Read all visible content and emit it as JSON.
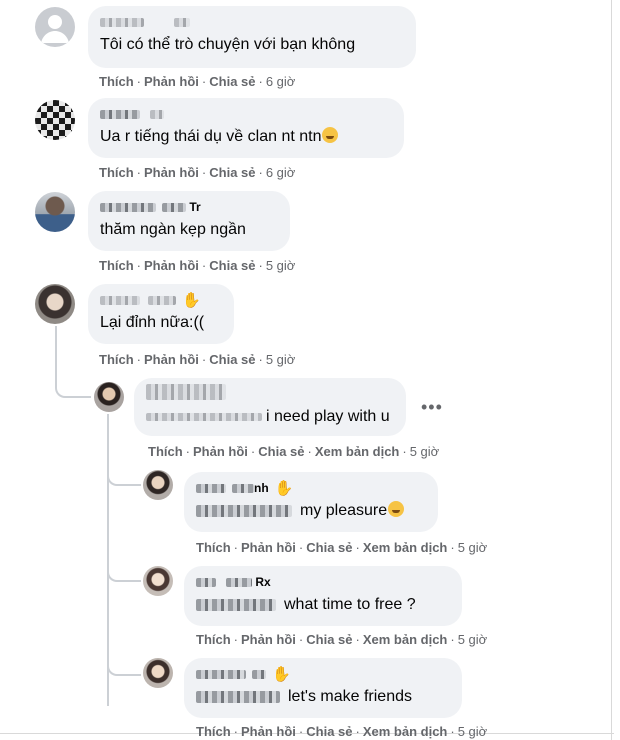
{
  "comments": [
    {
      "author": "",
      "author_suffix": "",
      "text": "Tôi có thể trò chuyện với bạn không",
      "actions": {
        "like": "Thích",
        "reply": "Phản hồi",
        "share": "Chia sẻ",
        "time": "6 giờ"
      }
    },
    {
      "author": "",
      "author_suffix": "",
      "text": "Ua r tiếng thái dụ về clan nt ntn",
      "actions": {
        "like": "Thích",
        "reply": "Phản hồi",
        "share": "Chia sẻ",
        "time": "6 giờ"
      }
    },
    {
      "author": "",
      "author_suffix": "Tr",
      "text": "thăm ngàn kẹp ngần",
      "actions": {
        "like": "Thích",
        "reply": "Phản hồi",
        "share": "Chia sẻ",
        "time": "5 giờ"
      }
    },
    {
      "author": "",
      "author_suffix": "",
      "text": "Lại đỉnh nữa:((",
      "actions": {
        "like": "Thích",
        "reply": "Phản hồi",
        "share": "Chia sẻ",
        "time": "5 giờ"
      }
    }
  ],
  "replies": [
    {
      "author": "",
      "author_suffix": "",
      "text": "i need play with u",
      "actions": {
        "like": "Thích",
        "reply": "Phản hồi",
        "share": "Chia sẻ",
        "translate": "Xem bản dịch",
        "time": "5 giờ"
      }
    },
    {
      "author": "",
      "author_suffix": "nh",
      "text": "my pleasure",
      "actions": {
        "like": "Thích",
        "reply": "Phản hồi",
        "share": "Chia sẻ",
        "translate": "Xem bản dịch",
        "time": "5 giờ"
      }
    },
    {
      "author": "",
      "author_suffix": "Rx",
      "text": "what time to free ?",
      "actions": {
        "like": "Thích",
        "reply": "Phản hồi",
        "share": "Chia sẻ",
        "translate": "Xem bản dịch",
        "time": "5 giờ"
      }
    },
    {
      "author": "",
      "author_suffix": "",
      "text": "let's make friends",
      "actions": {
        "like": "Thích",
        "reply": "Phản hồi",
        "share": "Chia sẻ",
        "translate": "Xem bản dịch",
        "time": "5 giờ"
      }
    }
  ],
  "more_menu_label": "•••",
  "wave_icon_glyph": "✋",
  "colors": {
    "bubble": "#f0f2f5",
    "secondary_text": "#65676b",
    "thread_line": "#ccd0d5"
  }
}
